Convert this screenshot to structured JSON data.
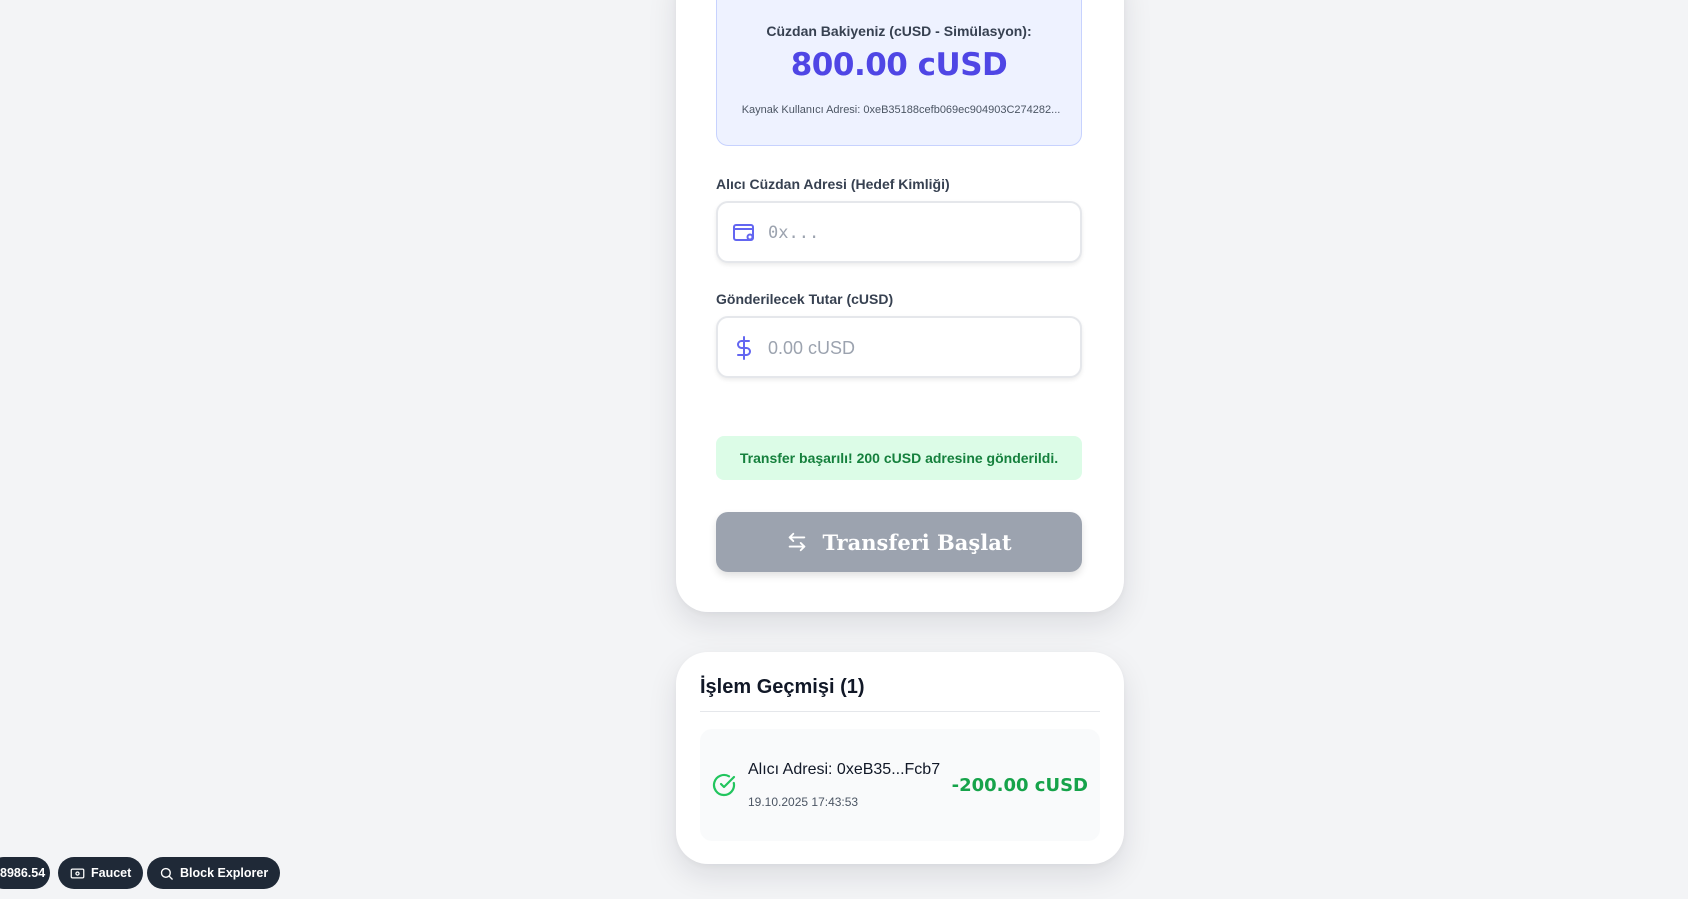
{
  "balance": {
    "caption": "Cüzdan Bakiyeniz (cUSD - Simülasyon):",
    "amount": "800.00 cUSD",
    "source_address": "Kaynak Kullanıcı Adresi: 0xeB35188cefb069ec904903C274282..."
  },
  "form": {
    "recipient_label": "Alıcı Cüzdan Adresi (Hedef Kimliği)",
    "recipient_placeholder": "0x...",
    "recipient_icon": "wallet-icon",
    "amount_label": "Gönderilecek Tutar (cUSD)",
    "amount_placeholder": "0.00 cUSD",
    "amount_icon": "dollar-icon",
    "success_message": "Transfer başarılı! 200 cUSD adresine gönderildi.",
    "submit_label": "Transferi Başlat",
    "submit_icon": "transfer-arrows-icon"
  },
  "history": {
    "title": "İşlem Geçmişi (1)",
    "items": [
      {
        "address": "Alıcı Adresi: 0xeB35...Fcb7",
        "date": "19.10.2025 17:43:53",
        "amount": "-200.00 cUSD",
        "status_icon": "check-circle-icon"
      }
    ]
  },
  "bottom_bar": {
    "balance_chip": "8986.54",
    "faucet_label": "Faucet",
    "explorer_label": "Block Explorer"
  },
  "colors": {
    "accent": "#4f46e5",
    "success": "#16a34a",
    "button_disabled": "#9ca3af"
  }
}
